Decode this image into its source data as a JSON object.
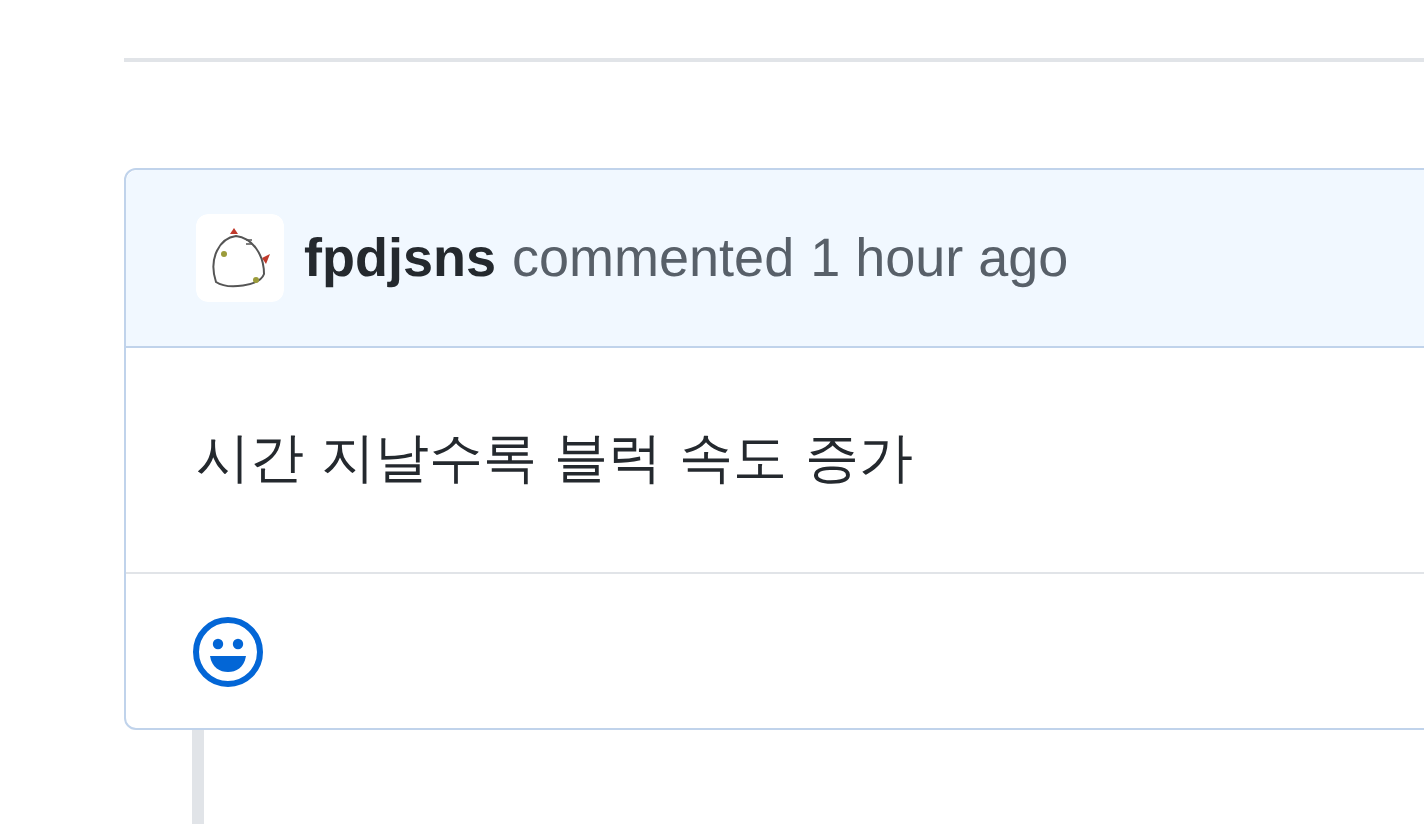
{
  "comment": {
    "author": "fpdjsns",
    "action": "commented",
    "time": "1 hour ago",
    "body": "시간 지날수록 블럭 속도 증가"
  }
}
